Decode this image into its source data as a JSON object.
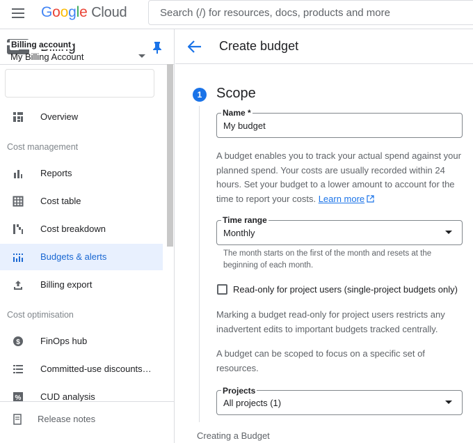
{
  "topbar": {
    "logo_google": "Google",
    "logo_cloud": "Cloud",
    "search_placeholder": "Search (/) for resources, docs, products and more"
  },
  "sidebar": {
    "title": "Billing",
    "billing_account": {
      "label": "Billing account",
      "value": "My Billing Account"
    },
    "items": [
      {
        "label": "Overview",
        "icon": "overview-icon"
      },
      {
        "label": "Reports",
        "icon": "bar-chart-icon"
      },
      {
        "label": "Cost table",
        "icon": "table-icon"
      },
      {
        "label": "Cost breakdown",
        "icon": "waterfall-icon"
      },
      {
        "label": "Budgets & alerts",
        "icon": "budget-icon",
        "active": true
      },
      {
        "label": "Billing export",
        "icon": "upload-icon"
      },
      {
        "label": "FinOps hub",
        "icon": "dollar-icon"
      },
      {
        "label": "Committed-use discounts…",
        "icon": "list-icon"
      },
      {
        "label": "CUD analysis",
        "icon": "percent-icon"
      }
    ],
    "sections": {
      "cost_management": "Cost management",
      "cost_optimisation": "Cost optimisation"
    },
    "release_notes": "Release notes"
  },
  "main": {
    "title": "Create budget",
    "step_number": "1",
    "step_title": "Scope",
    "name_field": {
      "label": "Name *",
      "value": "My budget"
    },
    "intro_text": "A budget enables you to track your actual spend against your planned spend. Your costs are usually recorded within 24 hours. Set your budget to a lower amount to account for the time to report your costs.",
    "learn_more": "Learn more",
    "time_range": {
      "label": "Time range",
      "value": "Monthly",
      "helper": "The month starts on the first of the month and resets at the beginning of each month."
    },
    "readonly_checkbox": {
      "label": "Read-only for project users (single-project budgets only)",
      "checked": false
    },
    "readonly_text": "Marking a budget read-only for project users restricts any inadvertent edits to important budgets tracked centrally.",
    "scope_text": "A budget can be scoped to focus on a specific set of resources.",
    "projects": {
      "label": "Projects",
      "value": "All projects (1)"
    }
  },
  "caption": "Creating a Budget",
  "colors": {
    "accent": "#1a73e8",
    "active_bg": "#e8f0fe",
    "active_text": "#1967d2"
  }
}
